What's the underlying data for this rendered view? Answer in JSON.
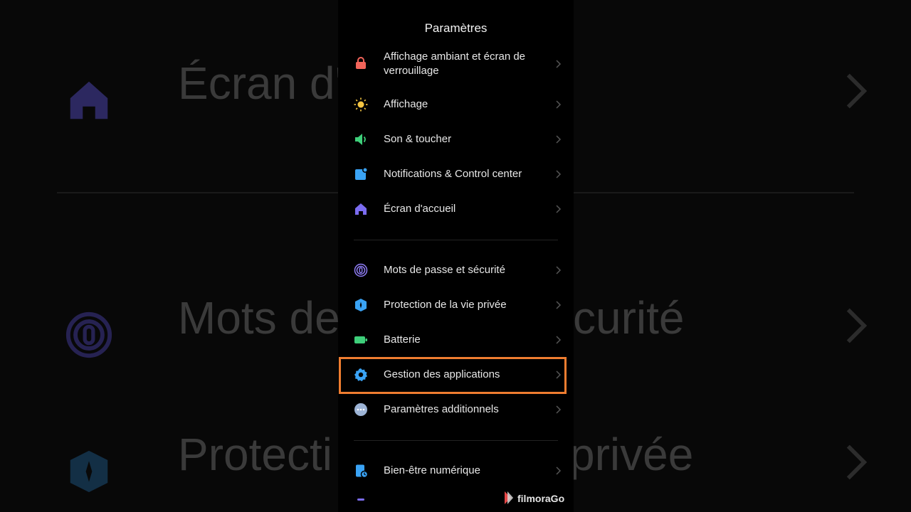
{
  "background": {
    "rows": [
      {
        "text": "Écran d'a",
        "icon": "home-icon"
      },
      {
        "text": "Mots de",
        "text_right": "curité",
        "icon": "fingerprint-icon"
      },
      {
        "text": "Protecti",
        "text_right": "privée",
        "icon": "shield-icon"
      }
    ]
  },
  "screen": {
    "title": "Paramètres",
    "sections": [
      {
        "items": [
          {
            "label": "Affichage ambiant et écran de verrouillage",
            "icon": "lock-icon",
            "color": "#f2645a"
          },
          {
            "label": "Affichage",
            "icon": "sun-icon",
            "color": "#f5c542"
          },
          {
            "label": "Son & toucher",
            "icon": "speaker-icon",
            "color": "#3ecf7a"
          },
          {
            "label": "Notifications & Control center",
            "icon": "notification-icon",
            "color": "#3aa3f5"
          },
          {
            "label": "Écran d'accueil",
            "icon": "home-icon",
            "color": "#7b6cf0"
          }
        ]
      },
      {
        "items": [
          {
            "label": "Mots de passe et sécurité",
            "icon": "fingerprint-icon",
            "color": "#8f7df5"
          },
          {
            "label": "Protection de la vie privée",
            "icon": "shield-icon",
            "color": "#3aa3f5"
          },
          {
            "label": "Batterie",
            "icon": "battery-icon",
            "color": "#3ecf7a"
          },
          {
            "label": "Gestion des applications",
            "icon": "gear-icon",
            "color": "#3aa3f5",
            "highlighted": true
          },
          {
            "label": "Paramètres additionnels",
            "icon": "more-icon",
            "color": "#9db4d6"
          }
        ]
      },
      {
        "items": [
          {
            "label": "Bien-être numérique",
            "icon": "wellbeing-icon",
            "color": "#3aa3f5"
          }
        ]
      }
    ],
    "highlight_color": "#ef7d30"
  },
  "watermark": {
    "text": "filmoraGo",
    "icon": "filmora-logo-icon"
  }
}
